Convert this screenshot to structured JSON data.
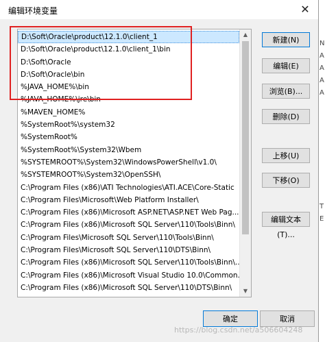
{
  "dialog": {
    "title": "编辑环境变量",
    "close_glyph": "✕"
  },
  "list": {
    "items": [
      "D:\\Soft\\Oracle\\product\\12.1.0\\client_1",
      "D:\\Soft\\Oracle\\product\\12.1.0\\client_1\\bin",
      "D:\\Soft\\Oracle",
      "D:\\Soft\\Oracle\\bin",
      "%JAVA_HOME%\\bin",
      "%JAVA_HOME%\\jre\\bin",
      "%MAVEN_HOME%",
      "%SystemRoot%\\system32",
      "%SystemRoot%",
      "%SystemRoot%\\System32\\Wbem",
      "%SYSTEMROOT%\\System32\\WindowsPowerShell\\v1.0\\",
      "%SYSTEMROOT%\\System32\\OpenSSH\\",
      "C:\\Program Files (x86)\\ATI Technologies\\ATI.ACE\\Core-Static",
      "C:\\Program Files\\Microsoft\\Web Platform Installer\\",
      "C:\\Program Files (x86)\\Microsoft ASP.NET\\ASP.NET Web Pag...",
      "C:\\Program Files (x86)\\Microsoft SQL Server\\110\\Tools\\Binn\\",
      "C:\\Program Files\\Microsoft SQL Server\\110\\Tools\\Binn\\",
      "C:\\Program Files\\Microsoft SQL Server\\110\\DTS\\Binn\\",
      "C:\\Program Files (x86)\\Microsoft SQL Server\\110\\Tools\\Binn\\...",
      "C:\\Program Files (x86)\\Microsoft Visual Studio 10.0\\Common...",
      "C:\\Program Files (x86)\\Microsoft SQL Server\\110\\DTS\\Binn\\"
    ],
    "selected_index": 0
  },
  "buttons": {
    "new": "新建(N)",
    "edit": "编辑(E)",
    "browse": "浏览(B)...",
    "delete": "删除(D)",
    "move_up": "上移(U)",
    "move_down": "下移(O)",
    "edit_text": "编辑文本(T)...",
    "ok": "确定",
    "cancel": "取消"
  },
  "background_fragments": [
    "N",
    "A",
    "A",
    "A",
    "A",
    "T",
    "E"
  ],
  "watermark": "https://blog.csdn.net/a506604248",
  "colors": {
    "selection": "#cce8ff",
    "highlight_box": "#e02020",
    "accent": "#0078d7"
  }
}
